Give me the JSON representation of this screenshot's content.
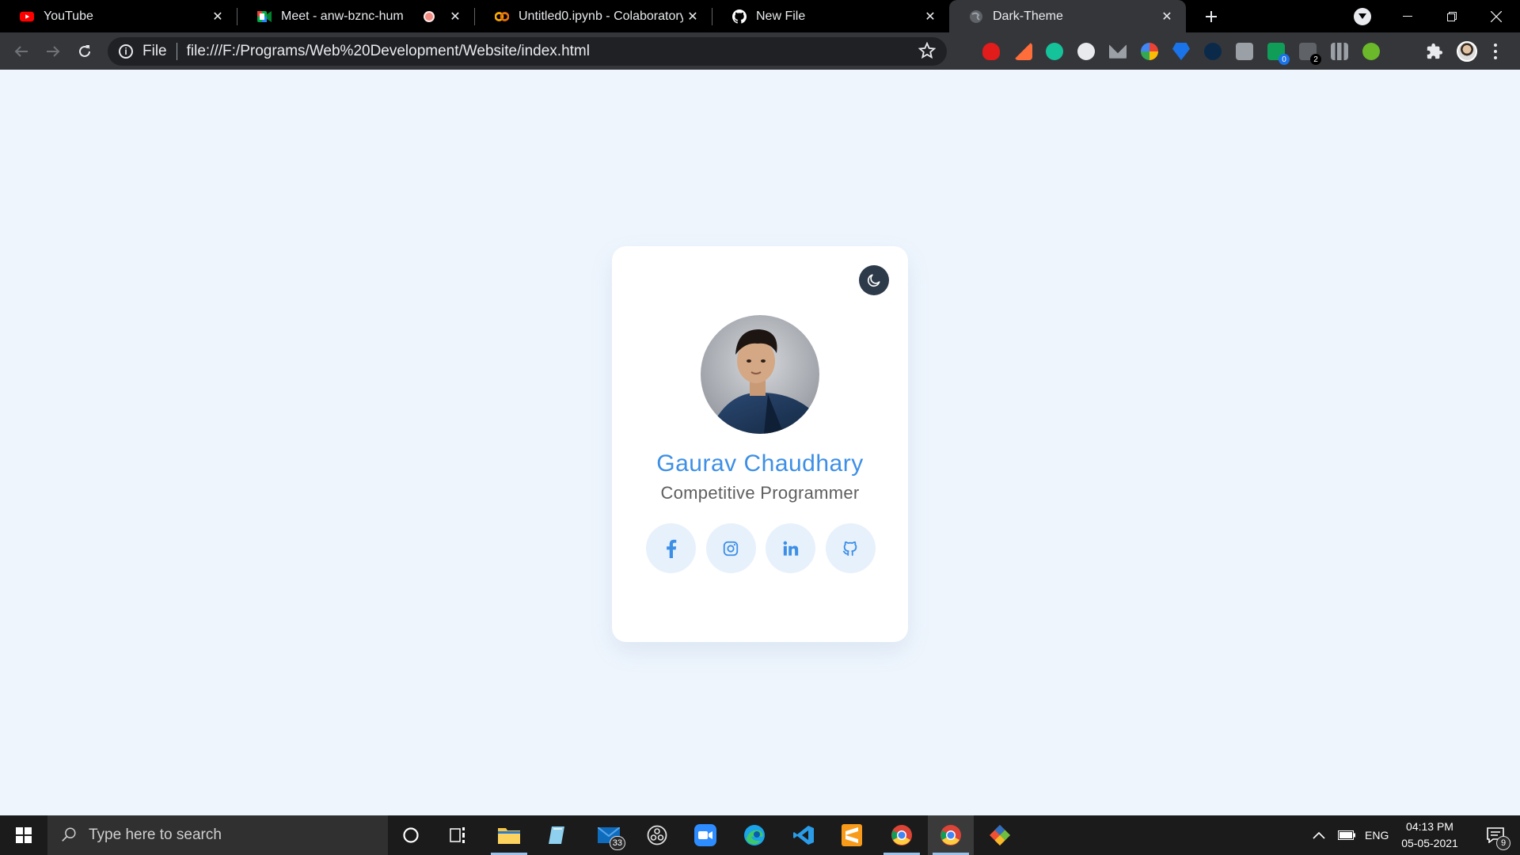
{
  "browser": {
    "tabs": [
      {
        "title": "YouTube",
        "favicon": "youtube-icon",
        "active": false
      },
      {
        "title": "Meet - anw-bznc-hum",
        "favicon": "google-meet-icon",
        "active": false,
        "recording": true
      },
      {
        "title": "Untitled0.ipynb - Colaboratory",
        "favicon": "colab-icon",
        "active": false
      },
      {
        "title": "New File",
        "favicon": "github-icon",
        "active": false
      },
      {
        "title": "Dark-Theme",
        "favicon": "globe-icon",
        "active": true
      }
    ],
    "address": {
      "scheme_label": "File",
      "url": "file:///F:/Programs/Web%20Development/Website/index.html"
    },
    "extension_badges": {
      "ext_a": "0",
      "ext_b": "2"
    }
  },
  "page": {
    "theme_toggle_icon": "moon-icon",
    "profile": {
      "name": "Gaurav Chaudhary",
      "role": "Competitive Programmer"
    },
    "socials": [
      {
        "name": "facebook",
        "icon": "facebook-icon"
      },
      {
        "name": "instagram",
        "icon": "instagram-icon"
      },
      {
        "name": "linkedin",
        "icon": "linkedin-icon"
      },
      {
        "name": "github",
        "icon": "github-icon"
      }
    ],
    "colors": {
      "background": "#eef5fd",
      "card": "#ffffff",
      "accent": "#3d8fe6",
      "social_bg": "#e7f1fc",
      "toggle_bg": "#2d3a4a"
    }
  },
  "taskbar": {
    "search_placeholder": "Type here to search",
    "mail_badge": "33",
    "language": "ENG",
    "time": "04:13 PM",
    "date": "05-05-2021",
    "notification_count": "9"
  }
}
